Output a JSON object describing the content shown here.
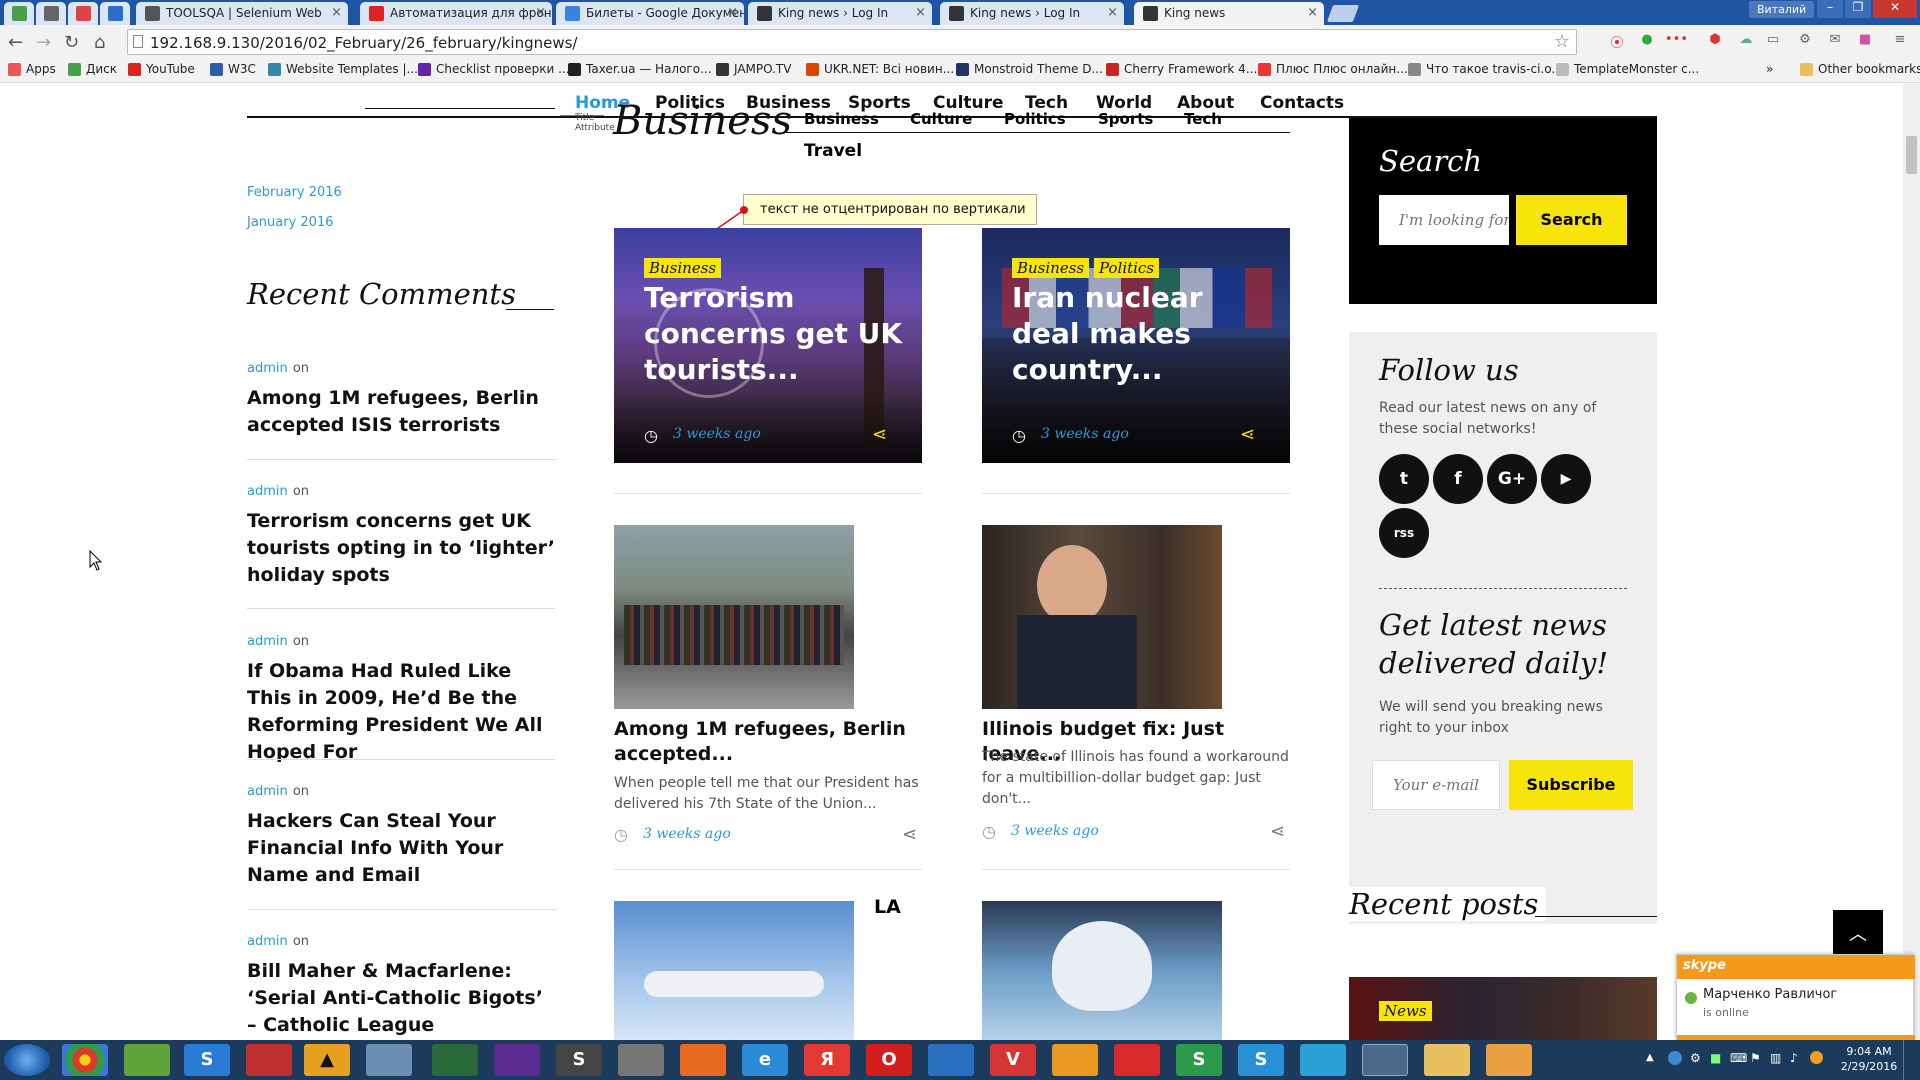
{
  "browser": {
    "tabs": [
      {
        "label": "",
        "color": "#4a9e4a"
      },
      {
        "label": "",
        "color": "#666"
      },
      {
        "label": "",
        "color": "#d44"
      },
      {
        "label": "",
        "color": "#2a6ec8"
      },
      {
        "label": "TOOLSQA | Selenium Web",
        "color": "#555"
      },
      {
        "label": "Автоматизация для фрон",
        "color": "#d22"
      },
      {
        "label": "Билеты - Google Докумен",
        "color": "#3b82e0"
      },
      {
        "label": "King news › Log In",
        "color": "#333"
      },
      {
        "label": "King news › Log In",
        "color": "#333"
      },
      {
        "label": "King news",
        "color": "#333"
      }
    ],
    "profile": "Виталий",
    "url": "192.168.9.130/2016/02_February/26_february/kingnews/",
    "bookmarks": [
      "Apps",
      "Диск",
      "YouTube",
      "W3C",
      "Website Templates |...",
      "Checklist проверки ...",
      "Taxer.ua — Налого...",
      "JAMPO.TV",
      "UKR.NET: Всі новин...",
      "Monstroid Theme D...",
      "Cherry Framework 4...",
      "Плюс Плюс онлайн...",
      "Что такое travis-ci.o...",
      "TemplateMonster c..."
    ],
    "other_bookmarks": "Other bookmarks",
    "more": "»"
  },
  "nav": {
    "items": [
      "Home",
      "Politics",
      "Business",
      "Sports",
      "Culture",
      "Tech",
      "World",
      "About",
      "Contacts"
    ],
    "active": "Home",
    "sub_items": [
      "Business",
      "Culture",
      "Politics",
      "Sports",
      "Tech"
    ],
    "travel": "Travel",
    "title_attr": "Title Attribute"
  },
  "left": {
    "archives": [
      "February 2016",
      "January 2016"
    ],
    "recent_comments_heading": "Recent Comments",
    "comments": [
      {
        "author": "admin",
        "on": "on",
        "title": "Among 1M refugees, Berlin accepted ISIS terrorists"
      },
      {
        "author": "admin",
        "on": "on",
        "title": "Terrorism concerns get UK tourists opting in to ‘lighter’ holiday spots"
      },
      {
        "author": "admin",
        "on": "on",
        "title": "If Obama Had Ruled Like This in 2009, He’d Be the Reforming President We All Hoped For"
      },
      {
        "author": "admin",
        "on": "on",
        "title": "Hackers Can Steal Your Financial Info With Your Name and Email"
      },
      {
        "author": "admin",
        "on": "on",
        "title": "Bill Maher & Macfarlene: ‘Serial Anti-Catholic Bigots’ – Catholic League"
      }
    ]
  },
  "main": {
    "heading": "Business",
    "annotation": "текст не отцентрирован по вертикали",
    "featured": [
      {
        "tags": [
          "Business"
        ],
        "title": "Terrorism concerns get UK tourists...",
        "ago": "3 weeks ago"
      },
      {
        "tags": [
          "Business",
          "Politics"
        ],
        "title": "Iran nuclear deal makes country...",
        "ago": "3 weeks ago"
      }
    ],
    "posts": [
      {
        "title": "Among 1M refugees, Berlin accepted...",
        "excerpt": "When people tell me that our President has delivered his 7th State of the Union...",
        "ago": "3 weeks ago"
      },
      {
        "title": "Illinois budget fix: Just leave...",
        "excerpt": "The state of Illinois has found a workaround for a multibillion-dollar budget gap: Just don't...",
        "ago": "3 weeks ago"
      }
    ],
    "la_label": "LA"
  },
  "sidebar": {
    "search_heading": "Search",
    "search_placeholder": "I'm looking for...",
    "search_button": "Search",
    "follow_heading": "Follow us",
    "follow_text": "Read our latest news on any of these social networks!",
    "social": [
      "t",
      "f",
      "G+",
      "▶",
      "rss"
    ],
    "newsletter_heading": "Get latest news delivered daily!",
    "newsletter_text": "We will send you breaking news right to your inbox",
    "email_placeholder": "Your e-mail",
    "subscribe_button": "Subscribe",
    "recent_posts_heading": "Recent posts",
    "recent_tag": "News"
  },
  "skype": {
    "brand": "skype",
    "contact": "Марченко Равличог",
    "status": "is online"
  },
  "taskbar": {
    "time": "9:04 AM",
    "date": "2/29/2016"
  },
  "colors": {
    "accent": "#f7e40a",
    "link": "#2a9ad6",
    "dark": "#111111",
    "panel": "#efefef"
  }
}
